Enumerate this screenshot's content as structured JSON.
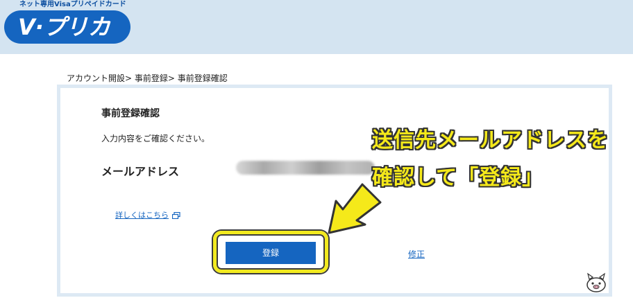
{
  "header": {
    "tagline": "ネット専用Visaプリペイドカード",
    "logo_text": "V·プリカ"
  },
  "breadcrumb": "アカウント開設> 事前登録> 事前登録確認",
  "main": {
    "section_title": "事前登録確認",
    "instruction": "入力内容をご確認ください。",
    "email_label": "メールアドレス",
    "details_link": "詳しくはこちら",
    "register_button": "登録",
    "fix_link": "修正"
  },
  "annotation": {
    "line1": "送信先メールアドレスを",
    "line2": "確認して「登録」"
  },
  "colors": {
    "brand_blue": "#1565c0",
    "header_bg": "#d4e4f1",
    "highlight_yellow": "#f2ea1f"
  },
  "icons": {
    "external": "external-link-icon",
    "arrow": "pointer-arrow-icon",
    "mascot": "pig-mascot-icon"
  }
}
